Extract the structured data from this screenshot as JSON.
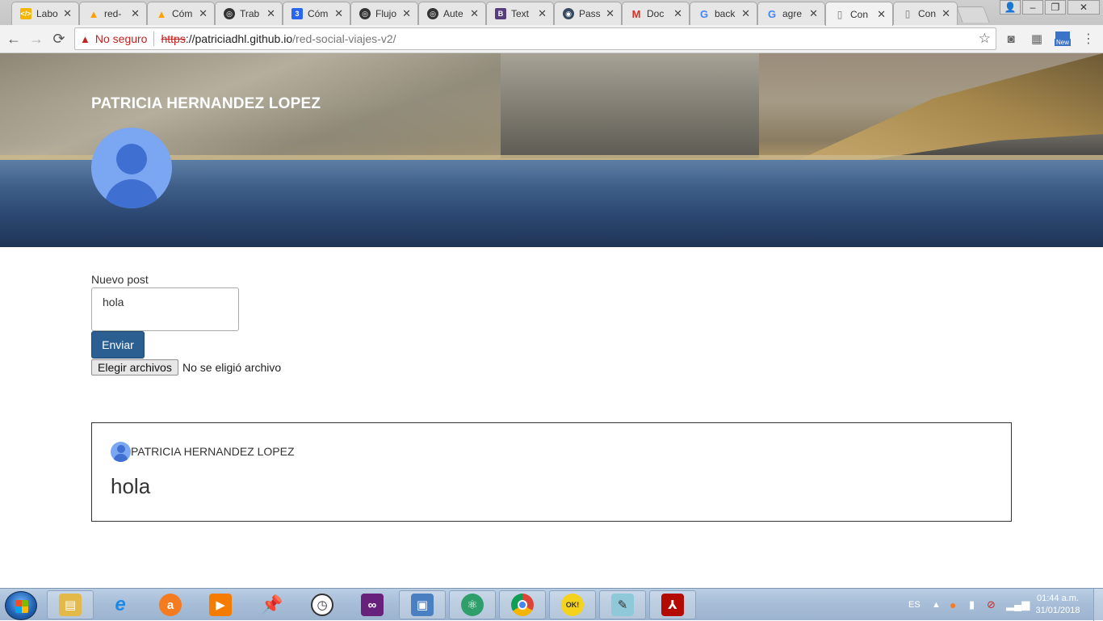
{
  "browser": {
    "tabs": [
      {
        "label": "Labo",
        "icon": "lab-icon",
        "color": "#f4b400"
      },
      {
        "label": "red-",
        "icon": "firebase-icon",
        "color": "#ffa000"
      },
      {
        "label": "Cóm",
        "icon": "firebase-icon",
        "color": "#ffa000"
      },
      {
        "label": "Trab",
        "icon": "codepen-icon",
        "color": "#333333"
      },
      {
        "label": "Cóm",
        "icon": "css3-icon",
        "color": "#2965f1"
      },
      {
        "label": "Flujo",
        "icon": "codepen-icon",
        "color": "#333333"
      },
      {
        "label": "Aute",
        "icon": "codepen-icon",
        "color": "#333333"
      },
      {
        "label": "Text",
        "icon": "bootstrap-icon",
        "color": "#563d7c"
      },
      {
        "label": "Pass",
        "icon": "passport-icon",
        "color": "#34495e"
      },
      {
        "label": "Doc",
        "icon": "gmail-icon",
        "color": "#d93025"
      },
      {
        "label": "back",
        "icon": "google-icon",
        "color": "#4285f4"
      },
      {
        "label": "agre",
        "icon": "google-icon",
        "color": "#4285f4"
      },
      {
        "label": "Con",
        "icon": "document-icon",
        "color": "#777777"
      },
      {
        "label": "Con",
        "icon": "document-icon",
        "color": "#777777"
      }
    ],
    "address": {
      "warning": "No seguro",
      "protocol": "https",
      "host": "://patriciadhl.github.io",
      "path": "/red-social-viajes-v2/"
    },
    "extension_badge": "New"
  },
  "profile": {
    "name": "PATRICIA HERNANDEZ LOPEZ"
  },
  "composer": {
    "label": "Nuevo post",
    "value": "hola",
    "send_label": "Enviar",
    "file_button": "Elegir archivos",
    "file_status": "No se eligió archivo"
  },
  "posts": [
    {
      "author": "PATRICIA HERNANDEZ LOPEZ",
      "content": "hola"
    }
  ],
  "taskbar": {
    "language": "ES",
    "time": "01:44 a.m.",
    "date": "31/01/2018"
  }
}
